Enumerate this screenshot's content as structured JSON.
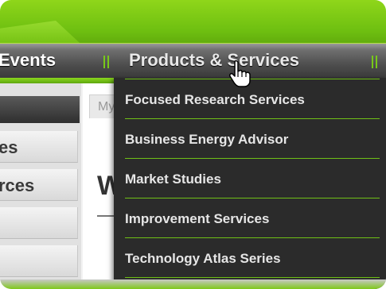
{
  "nav": {
    "items": [
      "Events",
      "Products & Services"
    ],
    "separator": "||"
  },
  "sidebar": {
    "items": [
      "es",
      "rces",
      "",
      ""
    ]
  },
  "content": {
    "tab_label": "My",
    "heading": "W"
  },
  "dropdown": {
    "items": [
      "Focused Research Services",
      "Business Energy Advisor",
      "Market Studies",
      "Improvement Services",
      "Technology Atlas Series"
    ]
  },
  "colors": {
    "brand_green": "#6fc011",
    "nav_dark": "#3a3a3a",
    "menu_bg": "#2b2b2b",
    "divider_green": "#6fc016"
  },
  "icons": {
    "cursor": "hand-pointer-icon"
  }
}
